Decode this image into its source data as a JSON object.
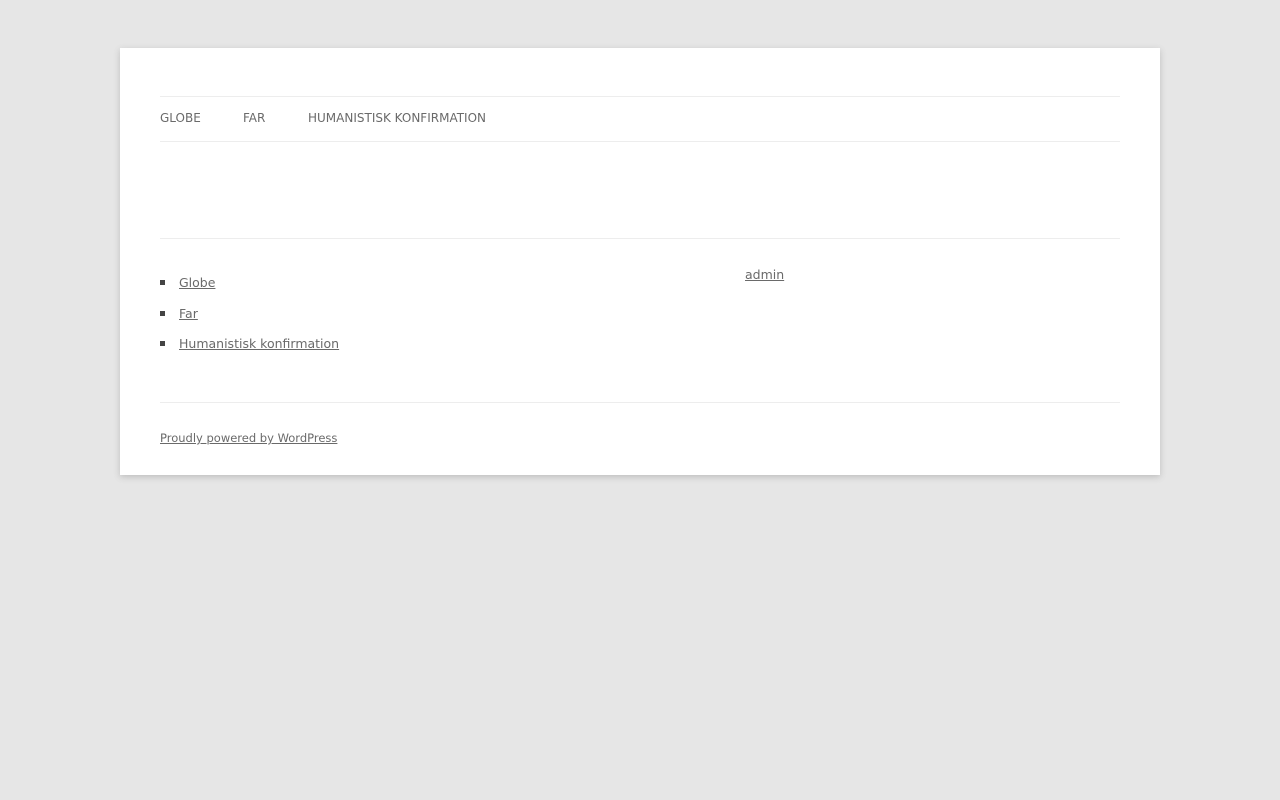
{
  "nav": {
    "items": [
      {
        "label": "GLOBE"
      },
      {
        "label": "FAR"
      },
      {
        "label": "HUMANISTISK KONFIRMATION"
      }
    ]
  },
  "widget": {
    "pages": [
      {
        "label": "Globe"
      },
      {
        "label": "Far"
      },
      {
        "label": "Humanistisk konfirmation"
      }
    ],
    "author_link": "admin"
  },
  "footer": {
    "credit": "Proudly powered by WordPress"
  }
}
